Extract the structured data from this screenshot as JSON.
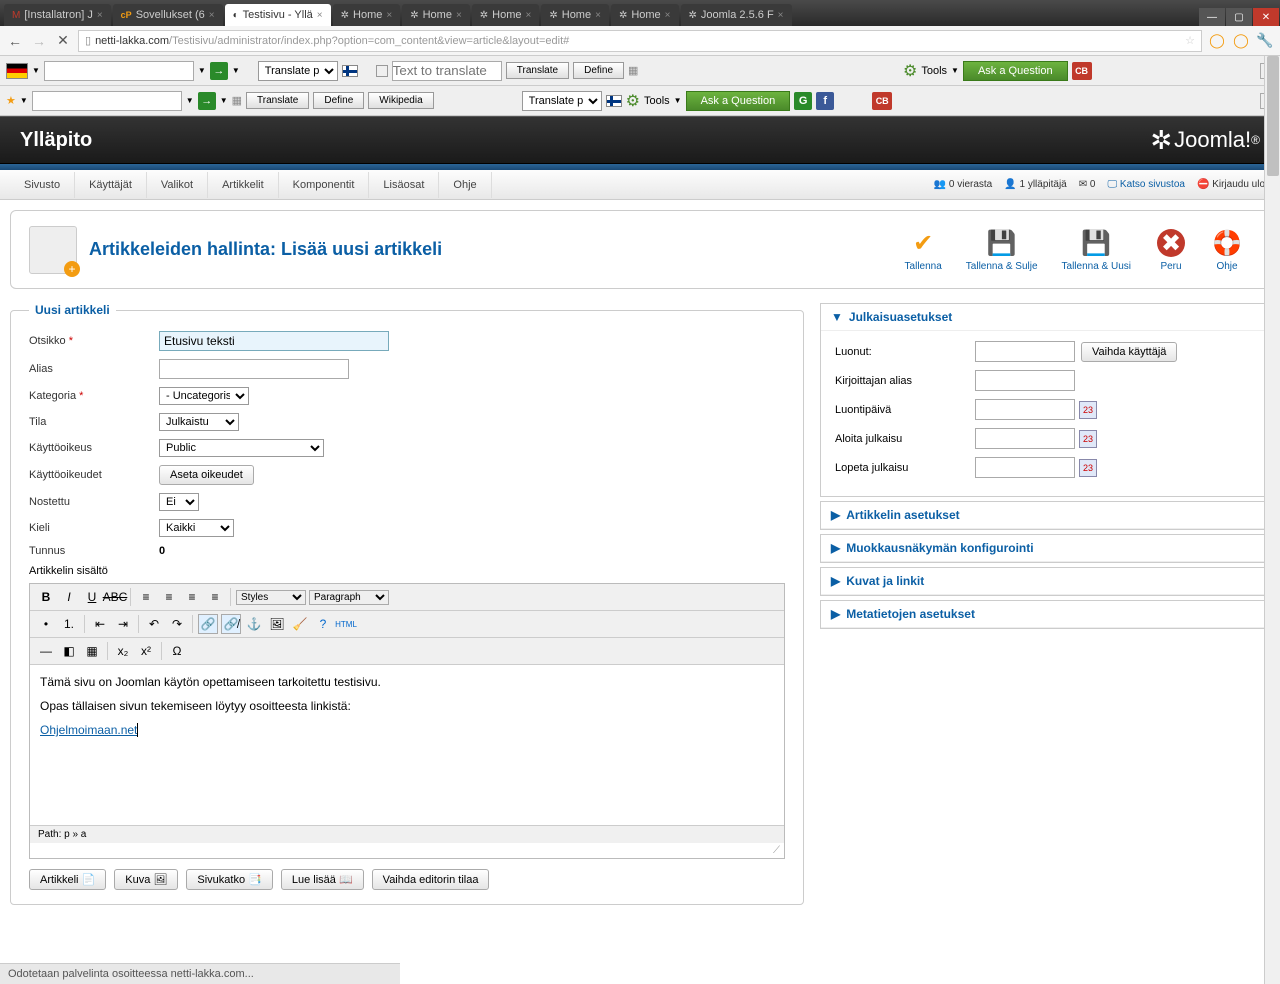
{
  "browser": {
    "tabs": [
      {
        "icon": "gmail",
        "label": "[Installatron] J"
      },
      {
        "icon": "cp",
        "label": "Sovellukset (6"
      },
      {
        "icon": "spinner",
        "label": "Testisivu - Yllä",
        "active": true
      },
      {
        "icon": "joomla",
        "label": "Home"
      },
      {
        "icon": "joomla",
        "label": "Home"
      },
      {
        "icon": "joomla",
        "label": "Home"
      },
      {
        "icon": "joomla",
        "label": "Home"
      },
      {
        "icon": "joomla",
        "label": "Home"
      },
      {
        "icon": "joomla",
        "label": "Joomla 2.5.6 F"
      }
    ],
    "url_host": "netti-lakka.com",
    "url_path": "/Testisivu/administrator/index.php?option=com_content&view=article&layout=edit#"
  },
  "toolbar1": {
    "translate_sel": "Translate pa",
    "text_placeholder": "Text to translate",
    "translate_btn": "Translate",
    "define_btn": "Define",
    "tools": "Tools",
    "ask": "Ask a Question"
  },
  "toolbar2": {
    "translate_btn": "Translate",
    "define_btn": "Define",
    "wiki_btn": "Wikipedia",
    "translate_sel": "Translate pa",
    "tools": "Tools",
    "ask": "Ask a Question"
  },
  "joomla": {
    "admin_title": "Ylläpito",
    "logo_text": "Joomla!",
    "menu": [
      "Sivusto",
      "Käyttäjät",
      "Valikot",
      "Artikkelit",
      "Komponentit",
      "Lisäosat",
      "Ohje"
    ],
    "status": {
      "guests": "0 vierasta",
      "admins": "1 ylläpitäjä",
      "msgs": "0",
      "view_site": "Katso sivustoa",
      "logout": "Kirjaudu ulos"
    },
    "page_title": "Artikkeleiden hallinta: Lisää uusi artikkeli",
    "actions": [
      {
        "id": "save",
        "label": "Tallenna",
        "icon": "✔",
        "color": "#f39c12"
      },
      {
        "id": "save_close",
        "label": "Tallenna & Sulje",
        "icon": "💾",
        "color": "#666"
      },
      {
        "id": "save_new",
        "label": "Tallenna & Uusi",
        "icon": "💾",
        "color": "#666"
      },
      {
        "id": "cancel",
        "label": "Peru",
        "icon": "✖",
        "color": "#c0392b"
      },
      {
        "id": "help",
        "label": "Ohje",
        "icon": "❓",
        "color": "#f39c12"
      }
    ],
    "fieldset_title": "Uusi artikkeli",
    "fields": {
      "title_lbl": "Otsikko",
      "title_val": "Etusivu teksti",
      "alias_lbl": "Alias",
      "alias_val": "",
      "category_lbl": "Kategoria",
      "category_val": "- Uncategorised",
      "state_lbl": "Tila",
      "state_val": "Julkaistu",
      "access_lbl": "Käyttöoikeus",
      "access_val": "Public",
      "perms_lbl": "Käyttöoikeudet",
      "perms_btn": "Aseta oikeudet",
      "featured_lbl": "Nostettu",
      "featured_val": "Ei",
      "lang_lbl": "Kieli",
      "lang_val": "Kaikki",
      "id_lbl": "Tunnus",
      "id_val": "0",
      "content_lbl": "Artikkelin sisältö"
    },
    "editor": {
      "styles": "Styles",
      "paragraph": "Paragraph",
      "html": "HTML",
      "content_p1": "Tämä sivu on Joomlan käytön opettamiseen tarkoitettu testisivu.",
      "content_p2": "Opas tällaisen sivun tekemiseen löytyy osoitteesta linkistä:",
      "content_link": "Ohjelmoimaan.net",
      "path": "Path: p » a",
      "btns": {
        "article": "Artikkeli",
        "image": "Kuva",
        "pagebreak": "Sivukatko",
        "readmore": "Lue lisää",
        "toggle": "Vaihda editorin tilaa"
      }
    },
    "sidebar": {
      "pub_title": "Julkaisuasetukset",
      "created_by": "Luonut:",
      "change_user": "Vaihda käyttäjä",
      "author_alias": "Kirjoittajan alias",
      "created": "Luontipäivä",
      "pub_up": "Aloita julkaisu",
      "pub_down": "Lopeta julkaisu",
      "panels": [
        "Artikkelin asetukset",
        "Muokkausnäkymän konfigurointi",
        "Kuvat ja linkit",
        "Metatietojen asetukset"
      ]
    }
  },
  "status_line": "Odotetaan palvelinta osoitteessa netti-lakka.com..."
}
